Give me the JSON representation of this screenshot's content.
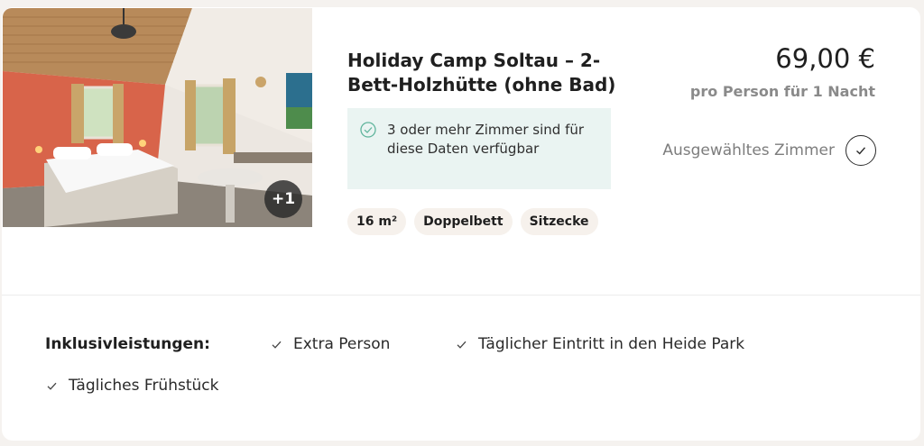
{
  "room": {
    "title": "Holiday Camp Soltau – 2-Bett-Holzhütte (ohne Bad)",
    "photo_extra_count": "+1",
    "availability_text": "3 oder mehr Zimmer sind für diese Daten verfügbar",
    "features": [
      "16 m²",
      "Doppelbett",
      "Sitzecke"
    ],
    "price": "69,00 €",
    "price_note": "pro Person für 1 Nacht",
    "selected_label": "Ausgewähltes Zimmer"
  },
  "inclusions": {
    "label": "Inklusivleistungen:",
    "items": [
      "Extra Person",
      "Täglicher Eintritt in den Heide Park",
      "Tägliches Frühstück"
    ]
  },
  "colors": {
    "availability_bg": "#eaf4f2",
    "check_green": "#5fb49c",
    "chip_bg": "#f6f1ec",
    "wall_red": "#d8644a"
  },
  "icons": {
    "availability": "check-circle-icon",
    "selected": "check-icon",
    "inclusion": "check-icon"
  }
}
